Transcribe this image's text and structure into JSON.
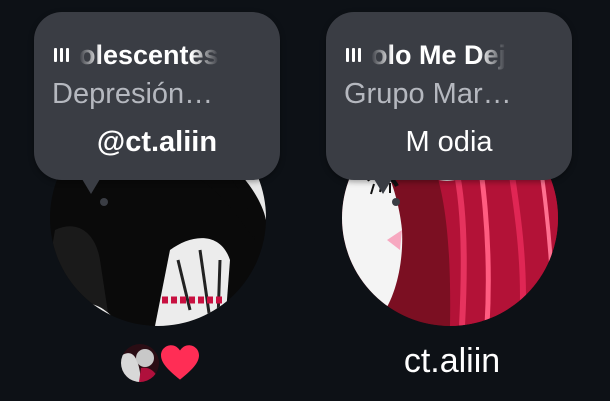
{
  "notes": [
    {
      "song_title": "olescentes",
      "artist": "Depresión…",
      "caption": "@ct.aliin"
    },
    {
      "song_title": "olo Me Dej",
      "artist": "Grupo Mar…",
      "caption": "M odia",
      "username": "ct.aliin"
    }
  ],
  "colors": {
    "background": "#0d1116",
    "bubble": "#3a3d44",
    "heart": "#ff2d55"
  },
  "icons": [
    "music-bars-icon",
    "skull-icon",
    "heart-icon"
  ]
}
